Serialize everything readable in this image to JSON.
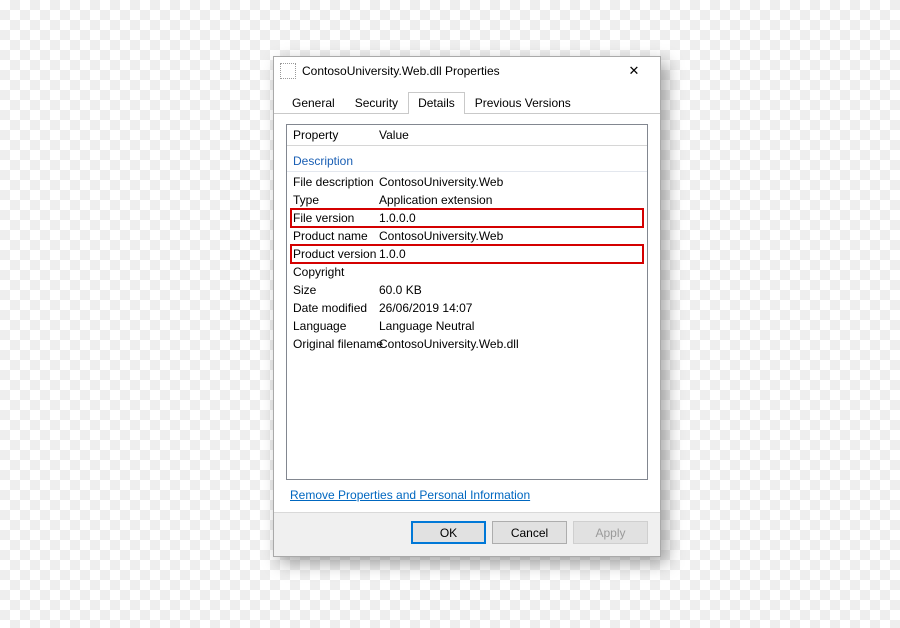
{
  "window": {
    "title": "ContosoUniversity.Web.dll Properties"
  },
  "tabs": {
    "general": "General",
    "security": "Security",
    "details": "Details",
    "previous": "Previous Versions"
  },
  "columns": {
    "property": "Property",
    "value": "Value"
  },
  "section": {
    "description": "Description"
  },
  "details": {
    "file_description": {
      "label": "File description",
      "value": "ContosoUniversity.Web"
    },
    "type": {
      "label": "Type",
      "value": "Application extension"
    },
    "file_version": {
      "label": "File version",
      "value": "1.0.0.0"
    },
    "product_name": {
      "label": "Product name",
      "value": "ContosoUniversity.Web"
    },
    "product_version": {
      "label": "Product version",
      "value": "1.0.0"
    },
    "copyright": {
      "label": "Copyright",
      "value": ""
    },
    "size": {
      "label": "Size",
      "value": "60.0 KB"
    },
    "date_modified": {
      "label": "Date modified",
      "value": "26/06/2019 14:07"
    },
    "language": {
      "label": "Language",
      "value": "Language Neutral"
    },
    "original_filename": {
      "label": "Original filename",
      "value": "ContosoUniversity.Web.dll"
    }
  },
  "link": {
    "remove": "Remove Properties and Personal Information"
  },
  "buttons": {
    "ok": "OK",
    "cancel": "Cancel",
    "apply": "Apply"
  }
}
